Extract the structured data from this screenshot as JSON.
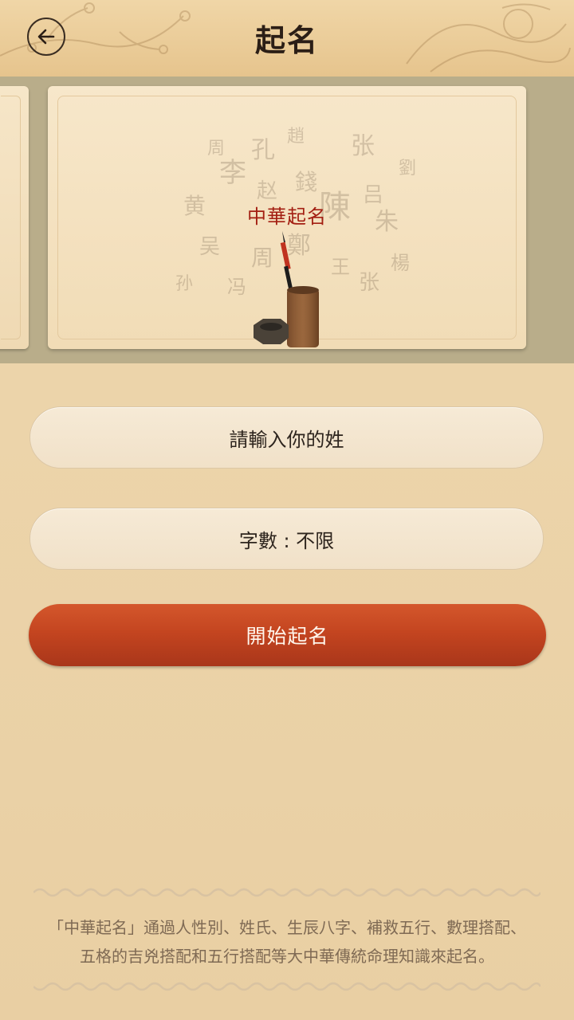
{
  "header": {
    "title": "起名",
    "back_icon": "arrow-left-icon"
  },
  "banner": {
    "card_title": "中華起名",
    "illustration": "brush-pot-icon"
  },
  "form": {
    "surname_placeholder": "請輸入你的姓",
    "char_count_label": "字數 : 不限",
    "start_button_label": "開始起名"
  },
  "description": {
    "line1": "「中華起名」通過人性別、姓氏、生辰八字、補救五行、數理搭配、",
    "line2": "五格的吉兇搭配和五行搭配等大中華傳統命理知識來起名。"
  },
  "colors": {
    "accent_red": "#c44520",
    "title_red": "#a31f12",
    "text_dark": "#2b1e16",
    "desc_text": "#7f6a54"
  }
}
